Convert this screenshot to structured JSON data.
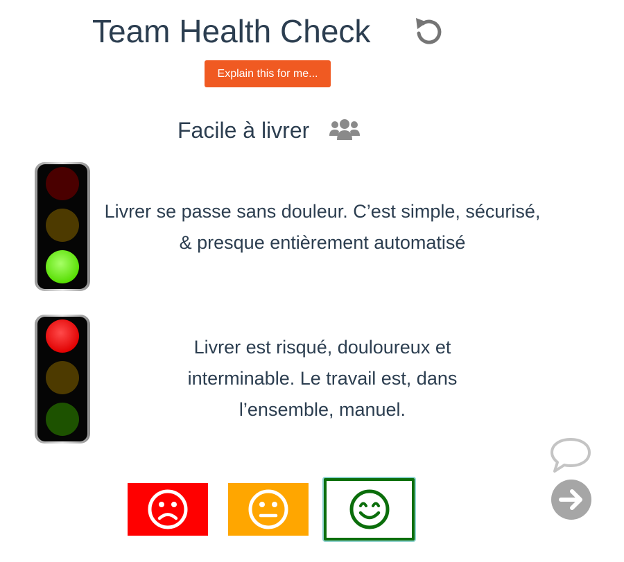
{
  "header": {
    "title": "Team Health Check",
    "reset_icon": "undo-icon"
  },
  "explain_button": {
    "label": "Explain this for me..."
  },
  "card": {
    "subtitle": "Facile à livrer",
    "subtitle_icon": "users-icon",
    "good": {
      "light": "green",
      "text": "Livrer se passe sans douleur. C’est simple, sécurisé, & presque entièrement automatisé"
    },
    "bad": {
      "light": "red",
      "text": "Livrer est risqué, douloureux et interminable. Le travail est, dans l’ensemble, manuel."
    }
  },
  "votes": [
    {
      "name": "red",
      "icon": "sad-face-icon",
      "color": "#ff0000"
    },
    {
      "name": "amber",
      "icon": "neutral-face-icon",
      "color": "#ffa600"
    },
    {
      "name": "green",
      "icon": "happy-face-icon",
      "color": "#0b6e0b",
      "selected": true
    }
  ],
  "side_controls": {
    "comment_icon": "speech-bubble-icon",
    "next_icon": "arrow-right-circle-icon"
  },
  "colors": {
    "text": "#2c3e50",
    "accent": "#f05a22",
    "red": "#ff0000",
    "amber": "#ffa600",
    "green": "#0b6e0b",
    "icon_grey": "#a6a6a6"
  }
}
